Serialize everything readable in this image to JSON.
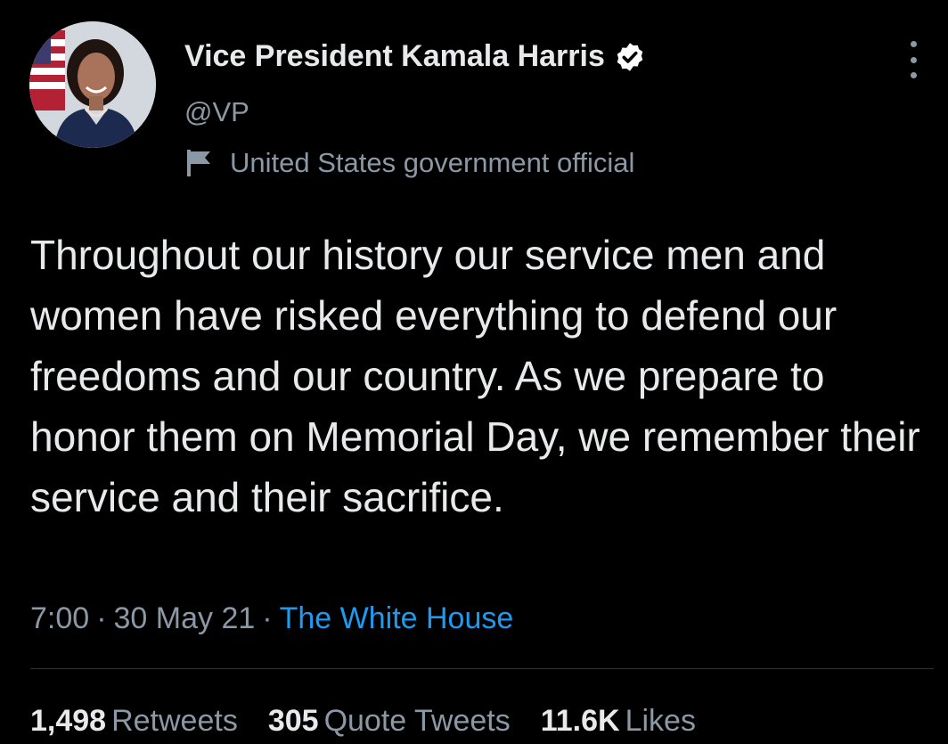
{
  "author": {
    "display_name": "Vice President Kamala Harris",
    "handle": "@VP",
    "label": "United States government official",
    "verified": true,
    "avatar_icon": "profile-photo",
    "label_icon": "flag-icon"
  },
  "tweet": {
    "text": "Throughout our history our service men and women have risked everything to defend our freedoms and our country. As we prepare to honor them on Memorial Day, we remember their service and their sacrifice.",
    "time": "7:00",
    "date": "30 May 21",
    "separator": "·",
    "source": "The White House"
  },
  "stats": {
    "retweets": {
      "count": "1,498",
      "label": "Retweets"
    },
    "quotes": {
      "count": "305",
      "label": "Quote Tweets"
    },
    "likes": {
      "count": "11.6K",
      "label": "Likes"
    }
  },
  "colors": {
    "background": "#000000",
    "primary_text": "#e7e9ea",
    "secondary_text": "#8b98a5",
    "link": "#1d9bf0",
    "divider": "#2f3336"
  }
}
